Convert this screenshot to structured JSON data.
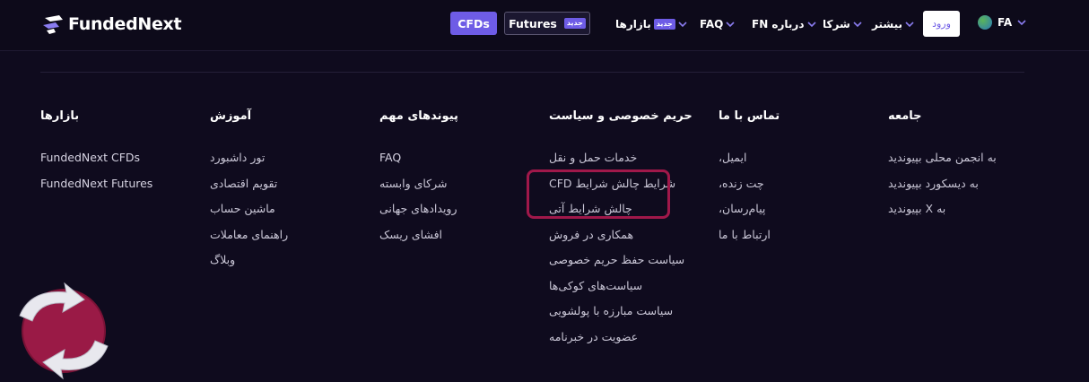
{
  "header": {
    "brand": "FundedNext",
    "cfds_button": "CFDs",
    "futures_button": "Futures",
    "futures_badge": "جدید",
    "nav": [
      {
        "label": "بازارها",
        "badge": "جدید"
      },
      {
        "label": "FAQ"
      },
      {
        "label": "FN درباره"
      },
      {
        "label": "شرکا"
      },
      {
        "label": "بیشتر"
      }
    ],
    "login": "ورود",
    "language": "FA"
  },
  "footer": {
    "columns": [
      {
        "title": "بازارها",
        "links": [
          "FundedNext CFDs",
          "FundedNext Futures"
        ]
      },
      {
        "title": "آموزش",
        "links": [
          "تور داشبورد",
          "تقویم اقتصادی",
          "ماشین حساب",
          "راهنمای معاملات",
          "وبلاگ"
        ]
      },
      {
        "title": "پیوندهای مهم",
        "links": [
          "FAQ",
          "شرکای وابسته",
          "رویدادهای جهانی",
          "افشای ریسک"
        ]
      },
      {
        "title": "حریم خصوصی و سیاست",
        "links": [
          "خدمات حمل و نقل",
          "CFD شرایط چالش شرایط",
          "چالش شرایط آتی",
          "همکاری در فروش",
          "سیاست حفظ حریم خصوصی",
          "سیاست‌های کوکی‌ها",
          "سیاست مبارزه با پولشویی",
          "عضویت در خبرنامه"
        ]
      },
      {
        "title": "تماس با ما",
        "links": [
          "،ایمیل",
          "،چت زنده",
          "،پیام‌رسان",
          "ارتباط با ما"
        ]
      },
      {
        "title": "جامعه",
        "links": [
          "به انجمن محلی بپیوندید",
          "به دیسکورد بپیوندید",
          "بپیوندید X به"
        ]
      }
    ]
  },
  "colors": {
    "accent": "#6e5ce6",
    "background": "#0f0b1e",
    "highlight": "#a0184a"
  }
}
